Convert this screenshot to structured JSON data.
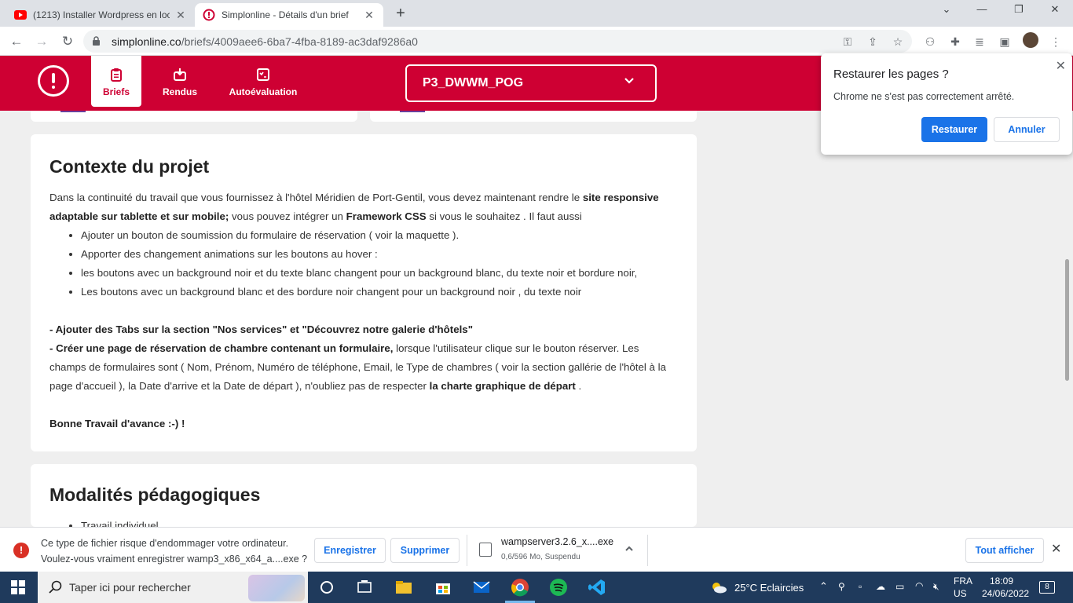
{
  "browser": {
    "tabs": [
      {
        "title": "(1213) Installer Wordpress en loc"
      },
      {
        "title": "Simplonline - Détails d'un brief"
      }
    ],
    "url_host": "simplonline.co",
    "url_path": "/briefs/4009aee6-6ba7-4fba-8189-ac3daf9286a0"
  },
  "site": {
    "nav": [
      {
        "label": "Briefs"
      },
      {
        "label": "Rendus"
      },
      {
        "label": "Autoévaluation"
      }
    ],
    "promo": "P3_DWWM_POG",
    "brand_color": "#ce0033"
  },
  "context": {
    "title": "Contexte du projet",
    "intro_1": "Dans la continuité du travail que vous fournissez à l'hôtel Méridien de Port-Gentil, vous devez maintenant rendre le ",
    "intro_bold_1": "site responsive adaptable sur tablette et sur mobile;",
    "intro_2": " vous pouvez intégrer un ",
    "intro_bold_2": "Framework CSS",
    "intro_3": " si vous le souhaitez . Il faut aussi",
    "bullets": [
      "Ajouter un bouton de soumission du formulaire de réservation ( voir la maquette ).",
      "Apporter des changement animations sur les boutons au hover :",
      "les boutons avec un background noir et du texte blanc changent pour un background blanc, du texte noir et bordure noir,",
      "Les boutons avec un background blanc et des bordure noir changent pour un background noir , du texte noir"
    ],
    "tabs_line": "- Ajouter des Tabs sur la section \"Nos services\" et \"Découvrez notre galerie d'hôtels\"",
    "booking_bold": "- Créer une page de réservation de chambre contenant un formulaire,",
    "booking_text": " lorsque l'utilisateur clique sur le bouton réserver. Les champs de formulaires sont ( Nom, Prénom, Numéro de téléphone, Email, le Type de chambres ( voir la section gallérie de l'hôtel à la page d'accueil ), la Date d'arrive et la Date de départ ), n'oubliez pas de respecter ",
    "booking_bold_2": "la charte graphique de départ",
    "booking_end": " .",
    "closing": "Bonne Travail d'avance :-) !"
  },
  "modalities": {
    "title": "Modalités pédagogiques",
    "bullets": [
      "Travail individuel"
    ]
  },
  "restore_popup": {
    "title": "Restaurer les pages ?",
    "message": "Chrome ne s'est pas correctement arrêté.",
    "restore_label": "Restaurer",
    "cancel_label": "Annuler"
  },
  "download_bar": {
    "warning_line1": "Ce type de fichier risque d'endommager votre ordinateur.",
    "warning_line2": "Voulez-vous vraiment enregistrer wamp3_x86_x64_a....exe ?",
    "save_label": "Enregistrer",
    "delete_label": "Supprimer",
    "file_name": "wampserver3.2.6_x....exe",
    "file_status": "0,6/596 Mo, Suspendu",
    "show_all_label": "Tout afficher"
  },
  "taskbar": {
    "search_placeholder": "Taper ici pour rechercher",
    "weather": "25°C  Eclaircies",
    "lang_1": "FRA",
    "lang_2": "US",
    "time": "18:09",
    "date": "24/06/2022",
    "notif_count": "8"
  }
}
